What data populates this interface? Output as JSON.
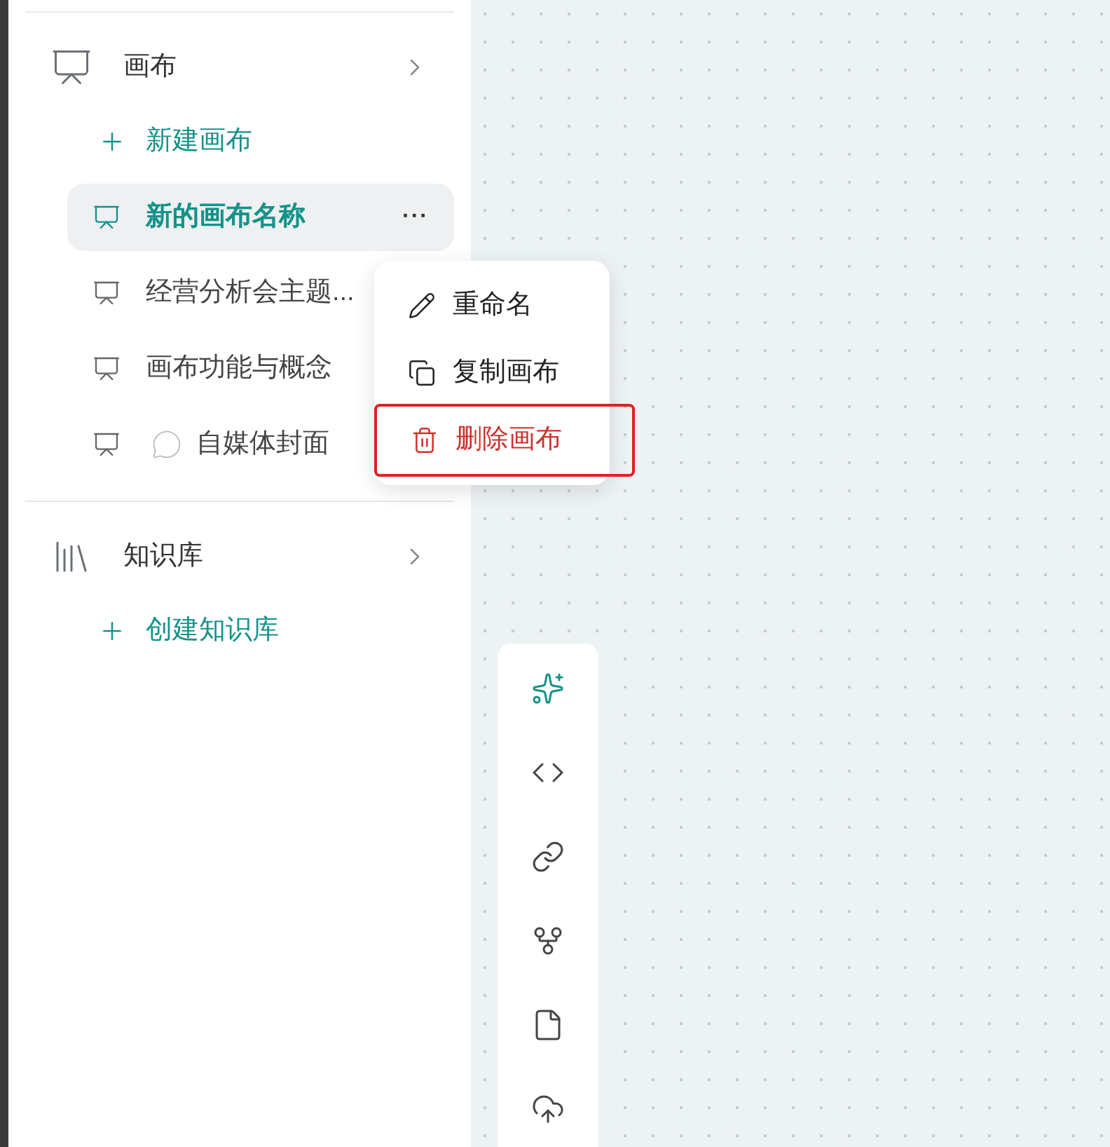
{
  "sections": [
    {
      "kind": "canvas",
      "title": "画布",
      "create": "新建画布",
      "items": [
        {
          "title": "新的画布名称",
          "selected": true,
          "comment": false,
          "more": "···"
        },
        {
          "title": "经营分析会主题...",
          "selected": false,
          "comment": false
        },
        {
          "title": "画布功能与概念",
          "selected": false,
          "comment": false
        },
        {
          "title": "自媒体封面",
          "selected": false,
          "comment": true
        }
      ]
    },
    {
      "kind": "library",
      "title": "知识库",
      "create": "创建知识库"
    }
  ],
  "context_menu": {
    "items": [
      {
        "kind": "rename",
        "label": "重命名",
        "danger": false,
        "highlighted": false
      },
      {
        "kind": "copy",
        "label": "复制画布",
        "danger": false,
        "highlighted": false
      },
      {
        "kind": "delete",
        "label": "删除画布",
        "danger": true,
        "highlighted": true
      }
    ]
  },
  "toolbar": {
    "tools": [
      {
        "kind": "sparkle",
        "selected": true
      },
      {
        "kind": "code",
        "selected": false
      },
      {
        "kind": "link",
        "selected": false
      },
      {
        "kind": "fork",
        "selected": false
      },
      {
        "kind": "note",
        "selected": false
      },
      {
        "kind": "upload",
        "selected": false
      }
    ]
  }
}
